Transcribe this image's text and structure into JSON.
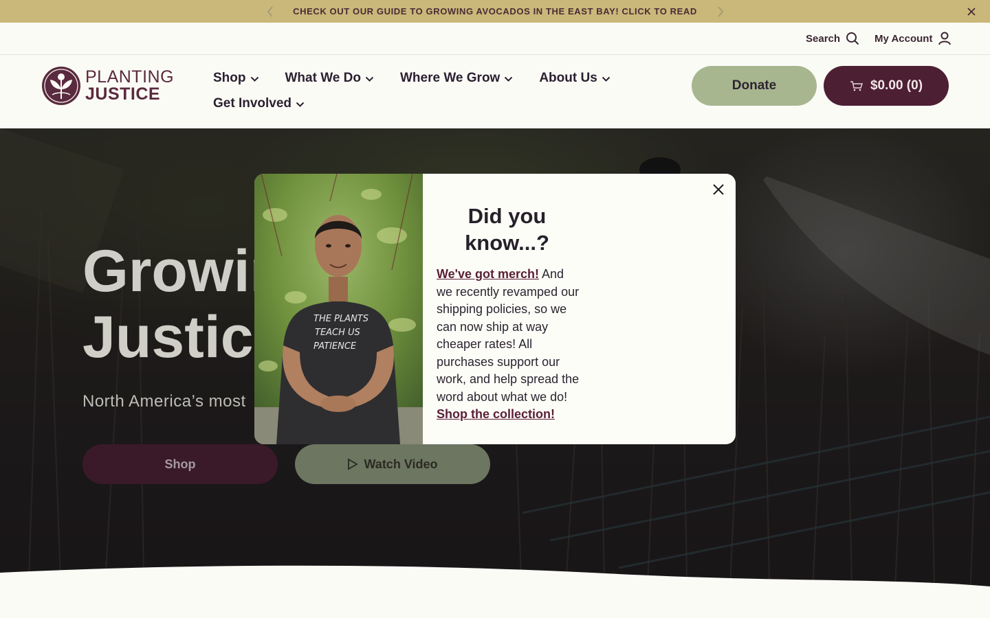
{
  "announcement": {
    "text": "CHECK OUT OUR GUIDE TO GROWING AVOCADOS IN THE EAST BAY! CLICK TO READ"
  },
  "utility": {
    "search_label": "Search",
    "account_label": "My Account"
  },
  "logo": {
    "line1": "PLANTING",
    "line2": "JUSTICE"
  },
  "nav": {
    "items": [
      "Shop",
      "What We Do",
      "Where We Grow",
      "About Us",
      "Get Involved"
    ]
  },
  "header": {
    "donate_label": "Donate",
    "cart_label": "$0.00 (0)"
  },
  "hero": {
    "title_line1": "Growin",
    "title_line2": "Justice",
    "subtitle": "North America’s most",
    "shop_label": "Shop",
    "video_label": "Watch Video"
  },
  "modal": {
    "title": "Did you know...?",
    "link1": "We've got merch!",
    "body": " And we recently revamped our shipping policies, so we can now ship at way cheaper rates! All purchases support our work, and help spread the word about what we do! ",
    "link2": "Shop the collection!",
    "shirt_text": [
      "THE PLANTS",
      "TEACH US",
      "PATIENCE"
    ]
  },
  "colors": {
    "announcement_bg": "#c9b87a",
    "brand_plum": "#4d1f33",
    "donate_green": "#a8b690",
    "link_plum": "#5a1e37"
  }
}
